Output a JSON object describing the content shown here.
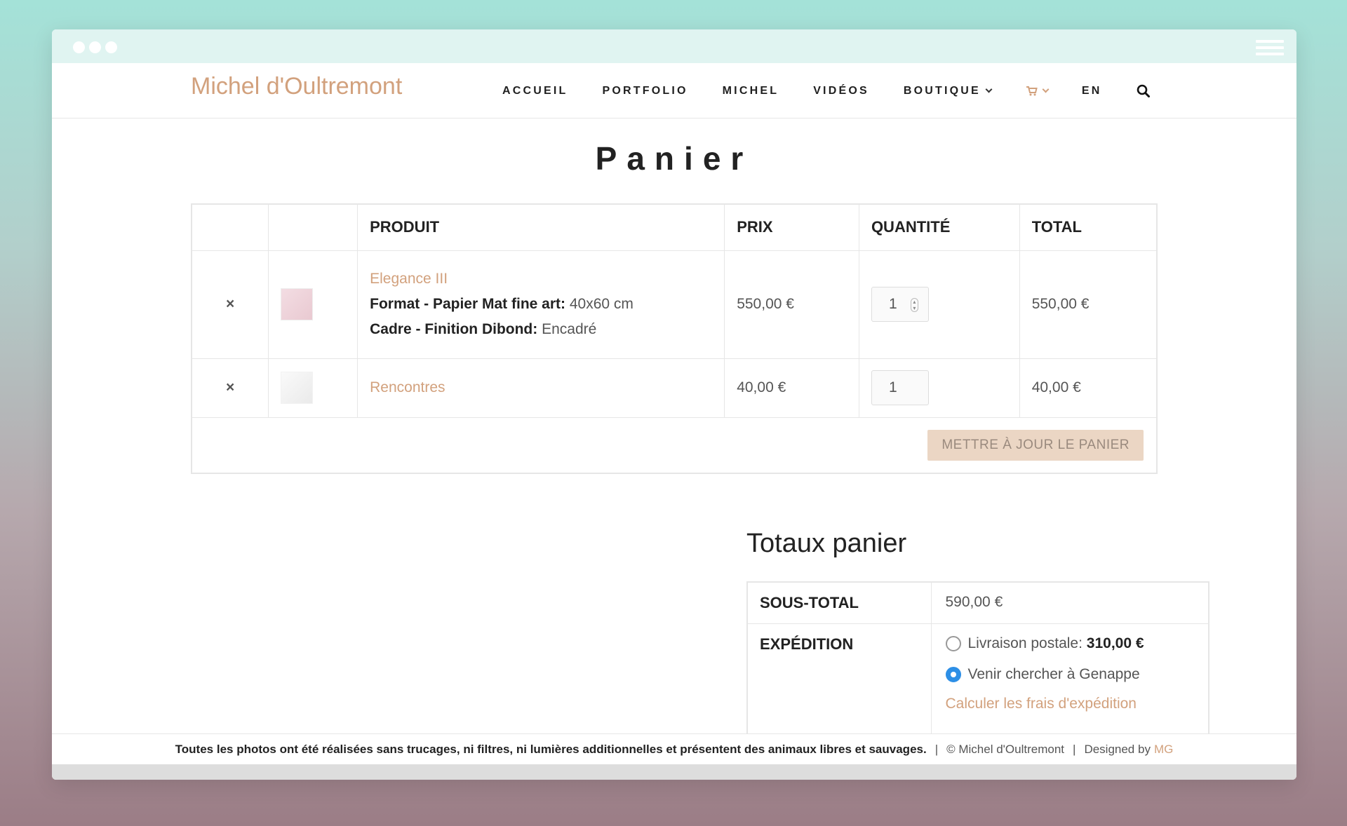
{
  "brand": {
    "name": "Michel d'Oultremont",
    "accent_color": "#d2a17d"
  },
  "window": {
    "dots": 3
  },
  "nav": {
    "items": [
      {
        "label": "ACCUEIL"
      },
      {
        "label": "PORTFOLIO"
      },
      {
        "label": "MICHEL"
      },
      {
        "label": "VIDÉOS"
      },
      {
        "label": "BOUTIQUE",
        "has_dropdown": true
      }
    ],
    "cart_icon": "cart-icon",
    "language": "EN",
    "search_icon": "search-icon"
  },
  "page": {
    "title": "Panier"
  },
  "cart": {
    "headers": {
      "product": "PRODUIT",
      "price": "PRIX",
      "quantity": "QUANTITÉ",
      "total": "TOTAL"
    },
    "items": [
      {
        "name": "Elegance III",
        "meta": [
          {
            "label": "Format - Papier Mat fine art:",
            "value": "40x60 cm"
          },
          {
            "label": "Cadre - Finition Dibond:",
            "value": "Encadré"
          }
        ],
        "price": "550,00 €",
        "quantity": "1",
        "total": "550,00 €"
      },
      {
        "name": "Rencontres",
        "price": "40,00 €",
        "quantity": "1",
        "total": "40,00 €"
      }
    ],
    "remove_symbol": "×",
    "update_button": "METTRE À JOUR LE PANIER"
  },
  "totals": {
    "title": "Totaux panier",
    "subtotal_label": "SOUS-TOTAL",
    "subtotal_value": "590,00 €",
    "shipping_label": "EXPÉDITION",
    "shipping_options": [
      {
        "label": "Livraison postale:",
        "price": "310,00 €",
        "selected": false
      },
      {
        "label": "Venir chercher à Genappe",
        "selected": true
      }
    ],
    "calc_link": "Calculer les frais d'expédition"
  },
  "footer": {
    "note": "Toutes les photos ont été réalisées sans trucages, ni filtres, ni lumières additionnelles et présentent des animaux libres et sauvages.",
    "separator": "|",
    "copyright": "© Michel d'Oultremont",
    "designed_by": "Designed by",
    "designer": "MG"
  }
}
